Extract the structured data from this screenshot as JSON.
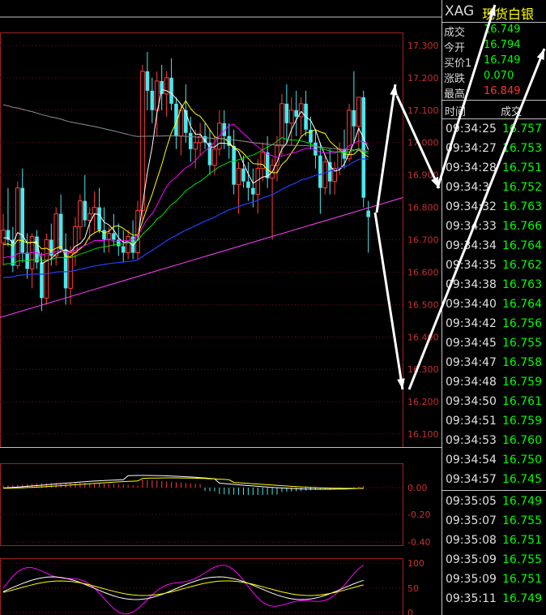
{
  "quote": {
    "code": "XAG",
    "name": "现货白银",
    "info": [
      {
        "label": "成交",
        "value": "16.749",
        "color": "green"
      },
      {
        "label": "今开",
        "value": "16.794",
        "color": "green"
      },
      {
        "label": "买价1",
        "value": "16.749",
        "color": "green"
      },
      {
        "label": "涨跌",
        "value": "0.070",
        "color": "green"
      },
      {
        "label": "最高",
        "value": "16.849",
        "color": "red"
      }
    ],
    "ticks_header": {
      "time": "时间",
      "price": "成交"
    },
    "ticks": [
      {
        "time": "09:34:25",
        "price": "16.757"
      },
      {
        "time": "09:34:27",
        "price": "16.753"
      },
      {
        "time": "09:34:28",
        "price": "16.751"
      },
      {
        "time": "09:34:3",
        "price": "16.752"
      },
      {
        "time": "09:34:32",
        "price": "16.763"
      },
      {
        "time": "09:34:33",
        "price": "16.766"
      },
      {
        "time": "09:34:34",
        "price": "16.764"
      },
      {
        "time": "09:34:35",
        "price": "16.762"
      },
      {
        "time": "09:34:38",
        "price": "16.763"
      },
      {
        "time": "09:34:40",
        "price": "16.764"
      },
      {
        "time": "09:34:42",
        "price": "16.756"
      },
      {
        "time": "09:34:45",
        "price": "16.755"
      },
      {
        "time": "09:34:47",
        "price": "16.758"
      },
      {
        "time": "09:34:48",
        "price": "16.759"
      },
      {
        "time": "09:34:50",
        "price": "16.761"
      },
      {
        "time": "09:34:51",
        "price": "16.759"
      },
      {
        "time": "09:34:53",
        "price": "16.760"
      },
      {
        "time": "09:34:54",
        "price": "16.750"
      },
      {
        "time": "09:34:57",
        "price": "16.745"
      },
      {
        "time": "09:35:05",
        "price": "16.749"
      },
      {
        "time": "09:35:07",
        "price": "16.755"
      },
      {
        "time": "09:35:08",
        "price": "16.751"
      },
      {
        "time": "09:35:09",
        "price": "16.755"
      },
      {
        "time": "09:35:09",
        "price": "16.751"
      },
      {
        "time": "09:35:11",
        "price": "16.749"
      }
    ]
  },
  "chart_data": [
    {
      "type": "candlestick",
      "ylim": [
        16.06,
        17.34
      ],
      "y_ticks": [
        "17.300",
        "17.200",
        "17.100",
        "17.000",
        "16.900",
        "16.800",
        "16.700",
        "16.600",
        "16.500",
        "16.400",
        "16.300",
        "16.200",
        "16.100"
      ],
      "grid": true,
      "candles": [
        [
          16.69,
          16.78,
          16.62,
          16.73
        ],
        [
          16.73,
          16.86,
          16.68,
          16.7
        ],
        [
          16.7,
          16.74,
          16.6,
          16.62
        ],
        [
          16.62,
          16.88,
          16.61,
          16.86
        ],
        [
          16.86,
          16.92,
          16.63,
          16.66
        ],
        [
          16.66,
          16.72,
          16.58,
          16.61
        ],
        [
          16.61,
          16.72,
          16.55,
          16.71
        ],
        [
          16.71,
          16.73,
          16.61,
          16.63
        ],
        [
          16.63,
          16.66,
          16.48,
          16.52
        ],
        [
          16.52,
          16.72,
          16.5,
          16.7
        ],
        [
          16.7,
          16.75,
          16.62,
          16.65
        ],
        [
          16.65,
          16.8,
          16.62,
          16.78
        ],
        [
          16.78,
          16.84,
          16.66,
          16.67
        ],
        [
          16.67,
          16.72,
          16.5,
          16.55
        ],
        [
          16.55,
          16.68,
          16.5,
          16.66
        ],
        [
          16.66,
          16.77,
          16.62,
          16.74
        ],
        [
          16.74,
          16.84,
          16.7,
          16.82
        ],
        [
          16.82,
          16.9,
          16.74,
          16.76
        ],
        [
          16.76,
          16.8,
          16.7,
          16.78
        ],
        [
          16.78,
          16.85,
          16.72,
          16.8
        ],
        [
          16.8,
          16.86,
          16.72,
          16.73
        ],
        [
          16.73,
          16.8,
          16.66,
          16.7
        ],
        [
          16.7,
          16.74,
          16.66,
          16.72
        ],
        [
          16.72,
          16.78,
          16.68,
          16.7
        ],
        [
          16.7,
          16.75,
          16.65,
          16.68
        ],
        [
          16.68,
          16.73,
          16.63,
          16.66
        ],
        [
          16.66,
          16.73,
          16.64,
          16.71
        ],
        [
          16.71,
          16.76,
          16.64,
          16.66
        ],
        [
          16.66,
          16.82,
          16.64,
          16.79
        ],
        [
          16.79,
          17.24,
          16.76,
          17.22
        ],
        [
          17.22,
          17.28,
          17.1,
          17.16
        ],
        [
          17.16,
          17.2,
          17.06,
          17.1
        ],
        [
          17.1,
          17.22,
          17.02,
          17.19
        ],
        [
          17.19,
          17.24,
          17.1,
          17.15
        ],
        [
          17.15,
          17.22,
          17.08,
          17.2
        ],
        [
          17.2,
          17.26,
          17.1,
          17.12
        ],
        [
          17.12,
          17.14,
          16.98,
          17.02
        ],
        [
          17.02,
          17.12,
          16.96,
          17.1
        ],
        [
          17.1,
          17.18,
          17.0,
          17.03
        ],
        [
          17.03,
          17.08,
          16.94,
          16.98
        ],
        [
          16.98,
          17.04,
          16.92,
          17.0
        ],
        [
          17.0,
          17.06,
          16.96,
          17.02
        ],
        [
          17.02,
          17.06,
          16.98,
          17.0
        ],
        [
          17.0,
          17.04,
          16.9,
          16.93
        ],
        [
          16.93,
          17.02,
          16.9,
          16.98
        ],
        [
          16.98,
          17.1,
          16.96,
          17.06
        ],
        [
          17.06,
          17.1,
          16.98,
          17.02
        ],
        [
          17.02,
          17.06,
          16.95,
          16.99
        ],
        [
          16.99,
          17.04,
          16.84,
          16.87
        ],
        [
          16.87,
          16.94,
          16.78,
          16.92
        ],
        [
          16.92,
          16.96,
          16.86,
          16.88
        ],
        [
          16.88,
          16.94,
          16.82,
          16.86
        ],
        [
          16.86,
          16.92,
          16.8,
          16.84
        ],
        [
          16.84,
          16.95,
          16.78,
          16.92
        ],
        [
          16.92,
          17.0,
          16.88,
          16.97
        ],
        [
          16.97,
          17.02,
          16.86,
          16.89
        ],
        [
          16.89,
          16.95,
          16.7,
          16.93
        ],
        [
          16.93,
          17.02,
          16.88,
          16.99
        ],
        [
          16.99,
          17.15,
          16.96,
          17.12
        ],
        [
          17.12,
          17.18,
          17.0,
          17.06
        ],
        [
          17.06,
          17.14,
          16.99,
          17.1
        ],
        [
          17.1,
          17.16,
          17.02,
          17.08
        ],
        [
          17.08,
          17.14,
          17.02,
          17.12
        ],
        [
          17.12,
          17.16,
          17.02,
          17.04
        ],
        [
          17.04,
          17.08,
          16.98,
          17.0
        ],
        [
          17.0,
          17.04,
          16.92,
          16.96
        ],
        [
          16.96,
          17.0,
          16.78,
          16.86
        ],
        [
          16.86,
          16.96,
          16.84,
          16.94
        ],
        [
          16.94,
          16.98,
          16.84,
          16.88
        ],
        [
          16.88,
          16.94,
          16.84,
          16.92
        ],
        [
          16.92,
          17.0,
          16.9,
          16.98
        ],
        [
          16.98,
          17.04,
          16.92,
          16.95
        ],
        [
          16.95,
          17.12,
          16.94,
          17.1
        ],
        [
          17.1,
          17.22,
          17.0,
          17.05
        ],
        [
          17.05,
          17.12,
          16.98,
          17.14
        ],
        [
          17.14,
          17.16,
          16.8,
          16.83
        ],
        [
          16.79,
          16.82,
          16.66,
          16.77
        ]
      ]
    },
    {
      "type": "line",
      "y_ticks": [
        "0.00",
        "-0.20",
        "-0.40"
      ]
    },
    {
      "type": "line",
      "y_ticks": [
        "100",
        "50",
        "0"
      ]
    }
  ]
}
